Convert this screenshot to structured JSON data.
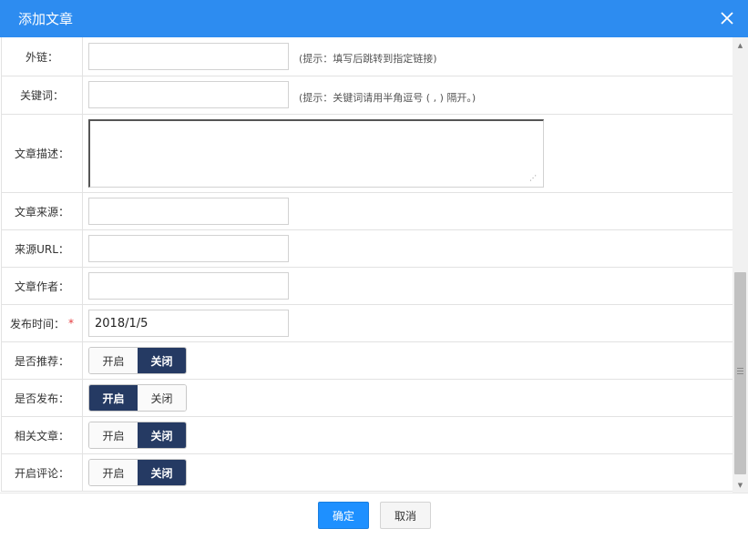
{
  "dialog": {
    "title": "添加文章",
    "close_icon": "close-icon"
  },
  "fields": {
    "external_link": {
      "label": "外链：",
      "value": "",
      "hint": "(提示：填写后跳转到指定链接)"
    },
    "keywords": {
      "label": "关键词：",
      "value": "",
      "hint": "(提示：关键词请用半角逗号 ( , ) 隔开。)"
    },
    "description": {
      "label": "文章描述：",
      "value": ""
    },
    "source": {
      "label": "文章来源：",
      "value": ""
    },
    "source_url": {
      "label": "来源URL：",
      "value": ""
    },
    "author": {
      "label": "文章作者：",
      "value": ""
    },
    "publish_time": {
      "label": "发布时间：",
      "required_mark": "*",
      "value": "2018/1/5"
    }
  },
  "toggles": {
    "recommend": {
      "label": "是否推荐：",
      "on_label": "开启",
      "off_label": "关闭",
      "selected": "off"
    },
    "publish": {
      "label": "是否发布：",
      "on_label": "开启",
      "off_label": "关闭",
      "selected": "on"
    },
    "related": {
      "label": "相关文章：",
      "on_label": "开启",
      "off_label": "关闭",
      "selected": "off"
    },
    "comments": {
      "label": "开启评论：",
      "on_label": "开启",
      "off_label": "关闭",
      "selected": "off"
    }
  },
  "footer": {
    "confirm_label": "确定",
    "cancel_label": "取消"
  },
  "colors": {
    "titlebar": "#2d8cf0",
    "toggle_active": "#253a63",
    "confirm_button": "#1e90ff",
    "required_mark": "#e4393c"
  }
}
